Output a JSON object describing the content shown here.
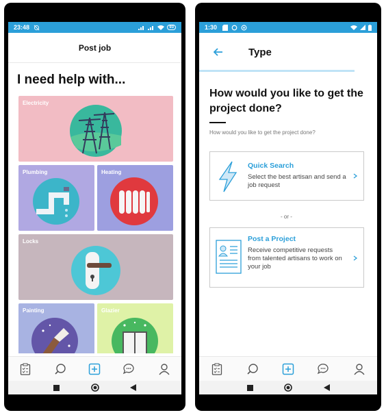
{
  "left": {
    "status": {
      "time": "23:48",
      "battery": "93"
    },
    "header": {
      "title": "Post job"
    },
    "heading": "I need help with...",
    "categories": [
      {
        "label": "Electricity",
        "color": "#f2bcc4"
      },
      {
        "label": "Plumbing",
        "color": "#b0a8e2"
      },
      {
        "label": "Heating",
        "color": "#9d9fe0"
      },
      {
        "label": "Locks",
        "color": "#c6b6bd"
      },
      {
        "label": "Painting",
        "color": "#a8b3e2"
      },
      {
        "label": "Glazier",
        "color": "#dff2a7"
      }
    ],
    "bottom_nav": [
      "clipboard-icon",
      "search-icon",
      "add-icon",
      "chat-icon",
      "profile-icon"
    ]
  },
  "right": {
    "status": {
      "time": "1:30",
      "battery": "84"
    },
    "header": {
      "title": "Type"
    },
    "question": "How would you like to get the project done?",
    "subtitle": "How would you like to get the project done?",
    "options": [
      {
        "title": "Quick Search",
        "description": "Select the best artisan and send a job request",
        "icon": "lightning-icon"
      },
      {
        "title": "Post a Project",
        "description": "Receive competitive requests from talented artisans to work on your job",
        "icon": "document-icon"
      }
    ],
    "separator": "- or -",
    "bottom_nav": [
      "clipboard-icon",
      "search-icon",
      "add-icon",
      "chat-icon",
      "profile-icon"
    ]
  },
  "colors": {
    "accent": "#2b9fd9",
    "status_bar": "#2b9fd9"
  }
}
